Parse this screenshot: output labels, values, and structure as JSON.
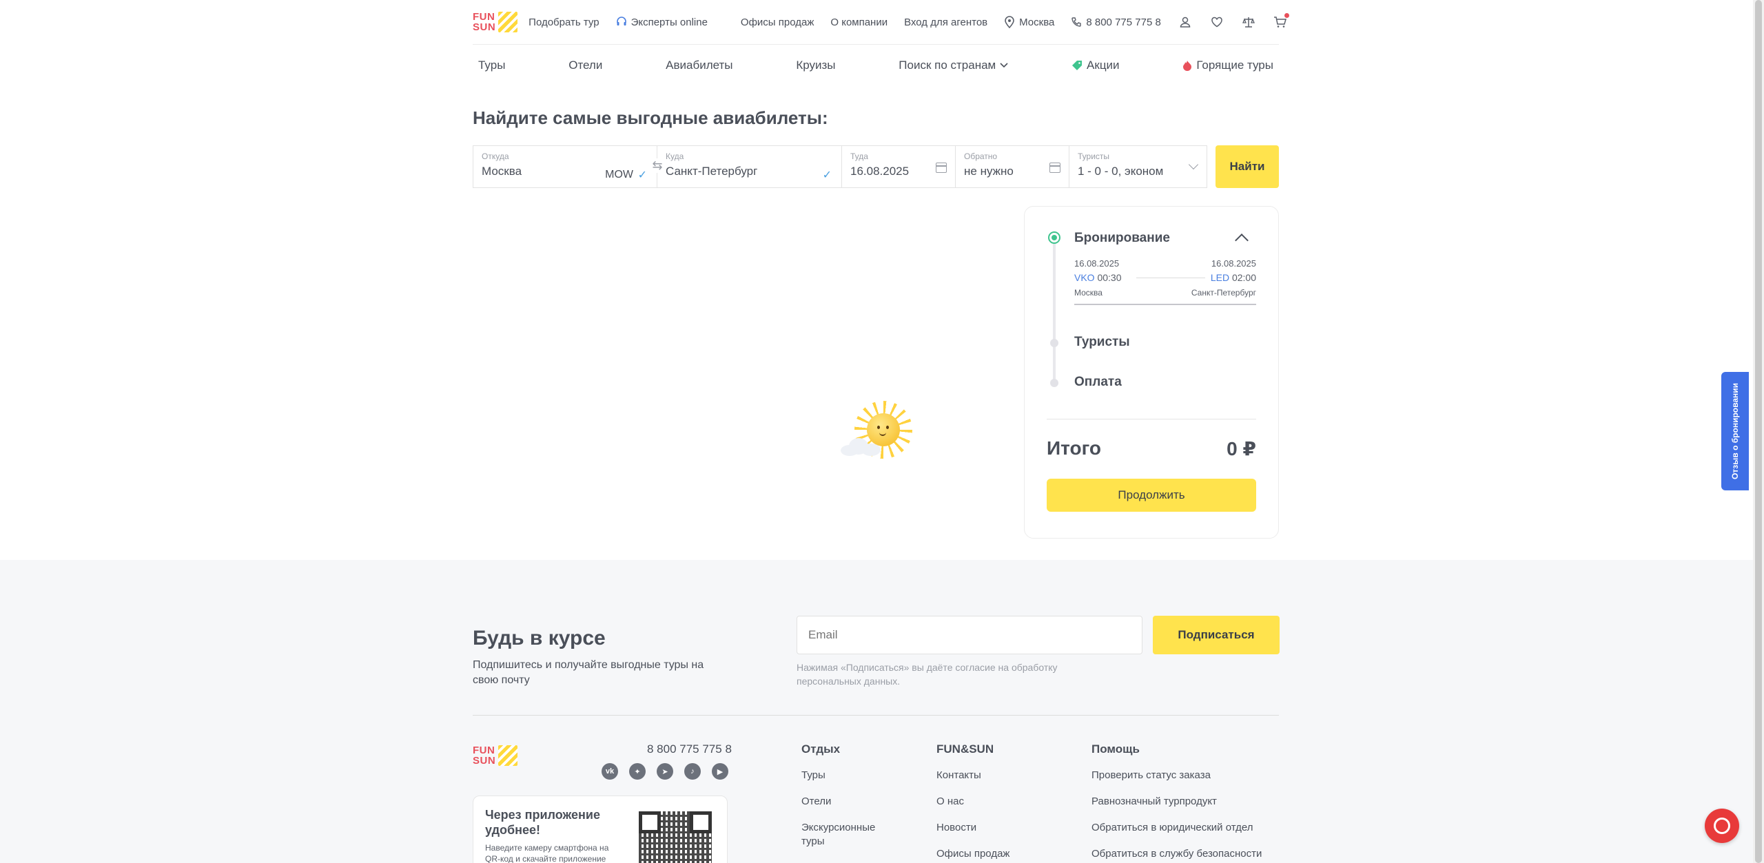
{
  "brand": {
    "logo_line1": "FUN",
    "logo_line2": "SUN",
    "accent": "#ffe34d",
    "logo_red": "#e8505b"
  },
  "topbar": {
    "links": [
      "Подобрать тур",
      "Эксперты online",
      "Офисы продаж",
      "О компании",
      "Вход для агентов"
    ],
    "city": "Москва",
    "phone": "8 800 775 775 8"
  },
  "mainnav": {
    "items": [
      "Туры",
      "Отели",
      "Авиабилеты",
      "Круизы",
      "Поиск по странам",
      "Акции",
      "Горящие туры"
    ]
  },
  "heading": "Найдите самые выгодные авиабилеты:",
  "search": {
    "from_label": "Откуда",
    "from_value": "Москва",
    "from_code": "MOW",
    "to_label": "Куда",
    "to_value": "Санкт-Петербург",
    "depart_label": "Туда",
    "depart_value": "16.08.2025",
    "return_label": "Обратно",
    "return_value": "не нужно",
    "tourists_label": "Туристы",
    "tourists_value": "1 - 0 - 0, эконом",
    "find_button": "Найти"
  },
  "booking": {
    "step1": "Бронирование",
    "segment": {
      "depart_date": "16.08.2025",
      "arrive_date": "16.08.2025",
      "depart_code": "VKO",
      "depart_time": "00:30",
      "arrive_code": "LED",
      "arrive_time": "02:00",
      "depart_city": "Москва",
      "arrive_city": "Санкт-Петербург"
    },
    "step2": "Туристы",
    "step3": "Оплата",
    "total_label": "Итого",
    "total_value": "0 ₽",
    "continue_button": "Продолжить"
  },
  "feedback_tab": "Отзыв о бронировании",
  "footer": {
    "subscribe_title": "Будь в курсе",
    "subscribe_desc": "Подпишитесь и получайте выгодные туры на свою почту",
    "email_placeholder": "Email",
    "subscribe_button": "Подписаться",
    "consent": "Нажимая «Подписаться» вы даёте согласие на обработку персональных данных.",
    "phone": "8 800 775 775 8",
    "socials": [
      "vk-icon",
      "dzen-icon",
      "telegram-icon",
      "tiktok-icon",
      "youtube-icon"
    ],
    "app_title": "Через приложение удобнее!",
    "app_desc": "Наведите камеру смартфона на QR-код и скачайте приложение",
    "col1_title": "Отдых",
    "col1_links": [
      "Туры",
      "Отели",
      "Экскурсионные туры"
    ],
    "col2_title": "FUN&SUN",
    "col2_links": [
      "Контакты",
      "О нас",
      "Новости",
      "Офисы продаж"
    ],
    "col3_title": "Помощь",
    "col3_links": [
      "Проверить статус заказа",
      "Равнозначный турпродукт",
      "Обратиться в юридический отдел",
      "Обратиться в службу безопасности"
    ]
  }
}
